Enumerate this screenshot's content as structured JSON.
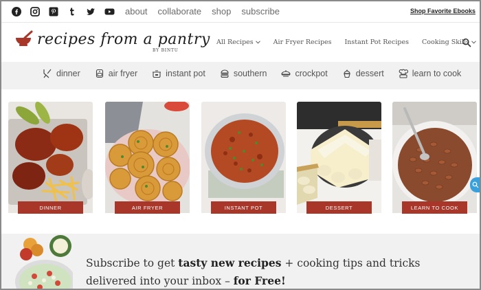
{
  "topbar": {
    "social": [
      {
        "icon": "facebook-icon"
      },
      {
        "icon": "instagram-icon"
      },
      {
        "icon": "pinterest-icon"
      },
      {
        "icon": "tumblr-icon"
      },
      {
        "icon": "twitter-icon"
      },
      {
        "icon": "youtube-icon"
      }
    ],
    "links": [
      "about",
      "collaborate",
      "shop",
      "subscribe"
    ],
    "shop_ebooks": "Shop Favorite Ebooks"
  },
  "header": {
    "logo_text": "recipes from a pantry",
    "logo_sub": "BY BINTU",
    "nav": [
      "All Recipes",
      "Air Fryer Recipes",
      "Instant Pot Recipes",
      "Cooking Skills"
    ]
  },
  "categories": [
    {
      "label": "dinner",
      "icon": "utensils-icon"
    },
    {
      "label": "air fryer",
      "icon": "air-fryer-icon"
    },
    {
      "label": "instant pot",
      "icon": "pressure-cooker-icon"
    },
    {
      "label": "southern",
      "icon": "burger-icon"
    },
    {
      "label": "crockpot",
      "icon": "crockpot-icon"
    },
    {
      "label": "dessert",
      "icon": "cupcake-icon"
    },
    {
      "label": "learn to cook",
      "icon": "chef-icon"
    }
  ],
  "cards": [
    "DINNER",
    "AIR FRYER",
    "INSTANT POT",
    "DESSERT",
    "LEARN TO COOK"
  ],
  "subscribe": {
    "p1": "Subscribe to get ",
    "b1": "tasty new recipes",
    "p2": " + cooking tips and tricks delivered into your inbox – ",
    "b2": "for Free!"
  },
  "colors": {
    "accent": "#a8372a",
    "catbar": "#f1f1f1",
    "scroll_tab": "#3aa0dc"
  }
}
